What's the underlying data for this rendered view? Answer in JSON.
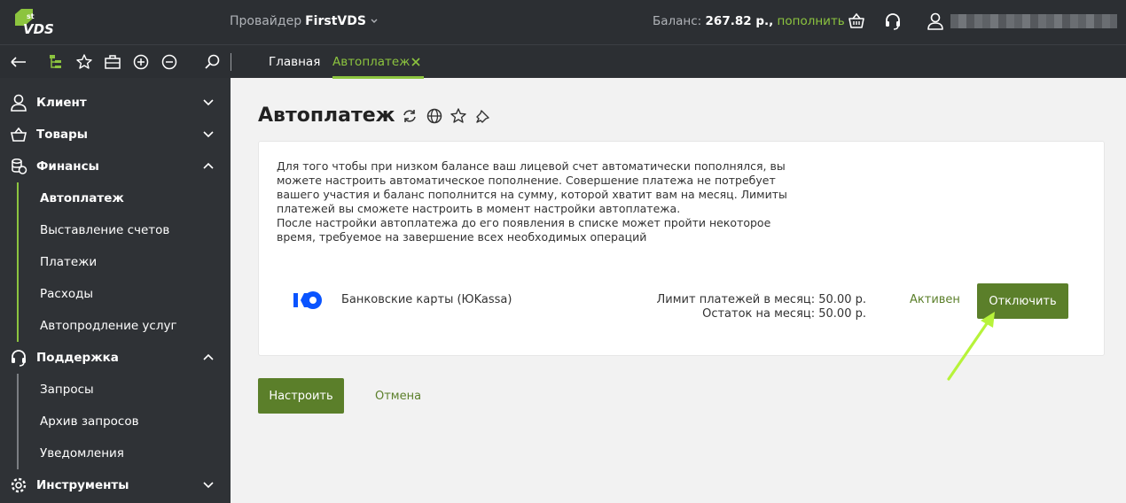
{
  "header": {
    "logo_text": "VDS",
    "logo_sup": "st",
    "provider_prefix": "Провайдер",
    "provider_name": "FirstVDS",
    "balance_label": "Баланс:",
    "balance_amount": "267.82 р.,",
    "balance_link": "пополнить",
    "icons": [
      "basket-icon",
      "headset-icon",
      "user-icon"
    ]
  },
  "toolbar": {
    "icons": [
      "back-arrow-icon",
      "tree-icon",
      "star-icon",
      "briefcase-icon",
      "plus-circle-icon",
      "minus-circle-icon",
      "search-icon"
    ],
    "tabs": [
      {
        "label": "Главная",
        "active": false
      },
      {
        "label": "Автоплатеж",
        "active": true
      }
    ]
  },
  "sidebar": {
    "groups": [
      {
        "label": "Клиент",
        "icon": "user-icon",
        "expanded": false
      },
      {
        "label": "Товары",
        "icon": "basket-icon",
        "expanded": false
      },
      {
        "label": "Финансы",
        "icon": "coins-icon",
        "expanded": true,
        "items": [
          "Автоплатеж",
          "Выставление счетов",
          "Платежи",
          "Расходы",
          "Автопродление услуг"
        ]
      },
      {
        "label": "Поддержка",
        "icon": "headset-icon",
        "expanded": true,
        "items": [
          "Запросы",
          "Архив запросов",
          "Уведомления"
        ]
      },
      {
        "label": "Инструменты",
        "icon": "gear-icon",
        "expanded": false
      }
    ],
    "active_item": "Автоплатеж"
  },
  "main": {
    "title": "Автоплатеж",
    "title_icons": [
      "refresh-icon",
      "globe-icon",
      "star-icon",
      "pin-icon"
    ],
    "description": [
      "Для того чтобы при низком балансе ваш лицевой счет автоматически пополнялся, вы",
      "можете настроить автоматическое пополнение. Совершение платежа не потребует",
      "вашего участия и баланс пополнится на сумму, которой хватит вам на месяц. Лимиты",
      "платежей вы сможете настроить в момент настройки автоплатежа.",
      "После настройки автоплатежа до его появления в списке может пройти некоторое",
      "время, требуемое на завершение всех необходимых операций"
    ],
    "payment_method": {
      "name": "Банковские карты (ЮKassa)",
      "limit": "Лимит платежей в месяц: 50.00 р.",
      "remaining": "Остаток на месяц: 50.00 р.",
      "status": "Активен",
      "disable_label": "Отключить"
    },
    "setup_label": "Настроить",
    "cancel_label": "Отмена"
  },
  "colors": {
    "accent": "#8cc43f",
    "button": "#5b7f2a",
    "dark_bg": "#2c2f33",
    "sidebar_bg": "#2f3236"
  }
}
